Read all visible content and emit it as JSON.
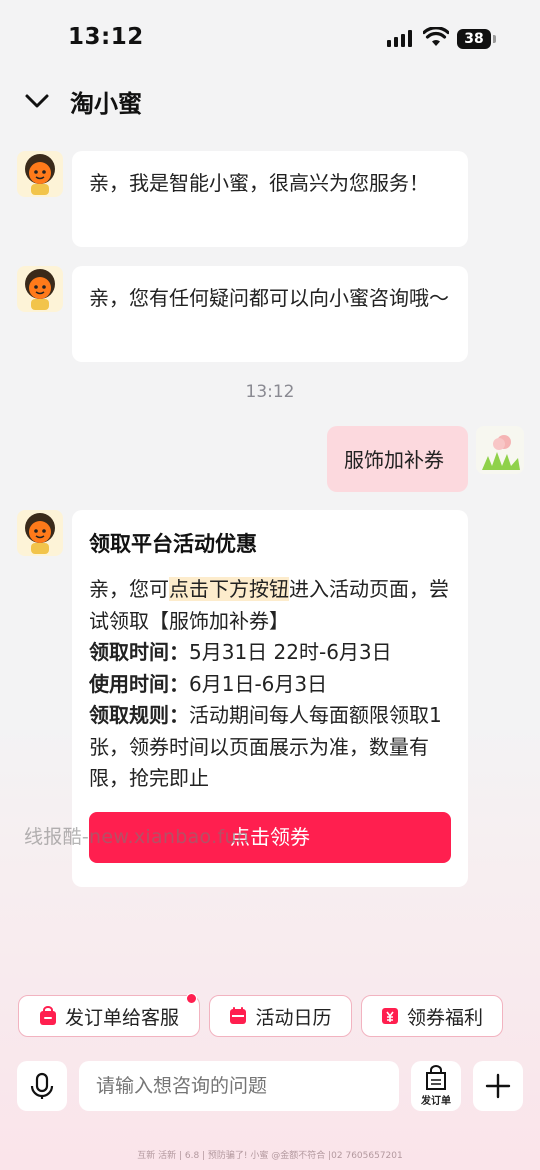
{
  "status_bar": {
    "time": "13:12",
    "battery": "38"
  },
  "header": {
    "title": "淘小蜜"
  },
  "messages": {
    "bot1": "亲，我是智能小蜜，很高兴为您服务！",
    "bot2": "亲，您有任何疑问都可以向小蜜咨询哦～",
    "timestamp": "13:12",
    "user": "服饰加补券",
    "card": {
      "title": "领取平台活动优惠",
      "intro_a": "亲，您可",
      "intro_highlight": "点击下方按钮",
      "intro_b": "进入活动页面，尝试领取【服饰加补券】",
      "claim_time_label": "领取时间：",
      "claim_time": "5月31日 22时-6月3日",
      "use_time_label": "使用时间：",
      "use_time": "6月1日-6月3日",
      "rule_label": "领取规则：",
      "rule": "活动期间每人每面额限领取1张，领券时间以页面展示为准，数量有限，抢完即止",
      "button": "点击领券"
    }
  },
  "watermark": "线报酷-new.xianbao.fun",
  "quick_actions": [
    "发订单给客服",
    "活动日历",
    "领券福利"
  ],
  "input": {
    "placeholder": "请输入想咨询的问题"
  },
  "order_button": "发订单",
  "footnote": "互新 活新 | 6.8 | 预防骗了! 小蜜 @金额不符合 |02 7605657201",
  "colors": {
    "accent": "#ff1f4f",
    "user_bubble": "#fcd9de"
  },
  "icons": [
    "chevron-down-icon",
    "signal-icon",
    "wifi-icon",
    "battery-icon",
    "mic-icon",
    "order-icon",
    "plus-icon",
    "bag-icon",
    "calendar-icon",
    "coupon-icon"
  ]
}
